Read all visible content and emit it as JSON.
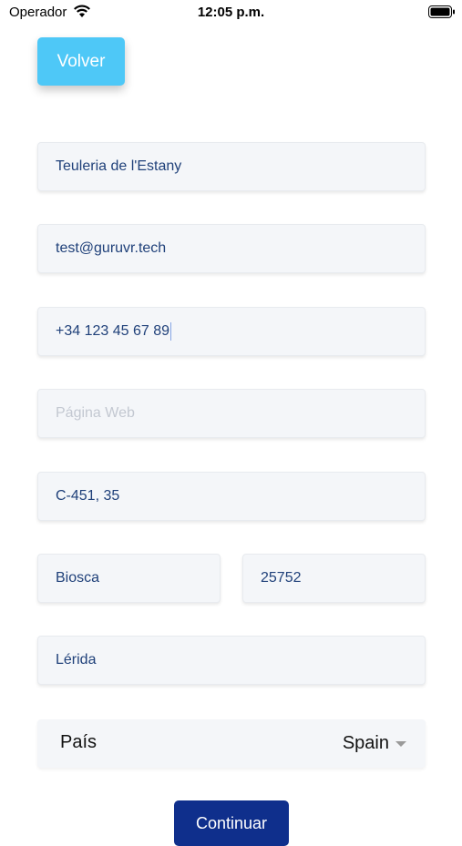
{
  "status_bar": {
    "carrier": "Operador",
    "time": "12:05 p.m.",
    "wifi_icon": "wifi-icon",
    "battery_icon": "battery-icon"
  },
  "back_button": {
    "label": "Volver"
  },
  "form": {
    "business_name": {
      "value": "Teuleria de l'Estany"
    },
    "email": {
      "value": "test@guruvr.tech"
    },
    "phone": {
      "value": "+34 123 45 67 89"
    },
    "website": {
      "value": "",
      "placeholder": "Página Web"
    },
    "address": {
      "value": "C-451, 35"
    },
    "city": {
      "value": "Biosca"
    },
    "postal_code": {
      "value": "25752"
    },
    "province": {
      "value": "Lérida"
    },
    "country": {
      "label": "País",
      "value": "Spain",
      "icon": "chevron-down-icon"
    }
  },
  "continue_button": {
    "label": "Continuar"
  },
  "colors": {
    "back_button_bg": "#4ec8f7",
    "field_bg": "#f4f6f9",
    "field_text": "#20417a",
    "continue_button_bg": "#0f2f8c"
  }
}
